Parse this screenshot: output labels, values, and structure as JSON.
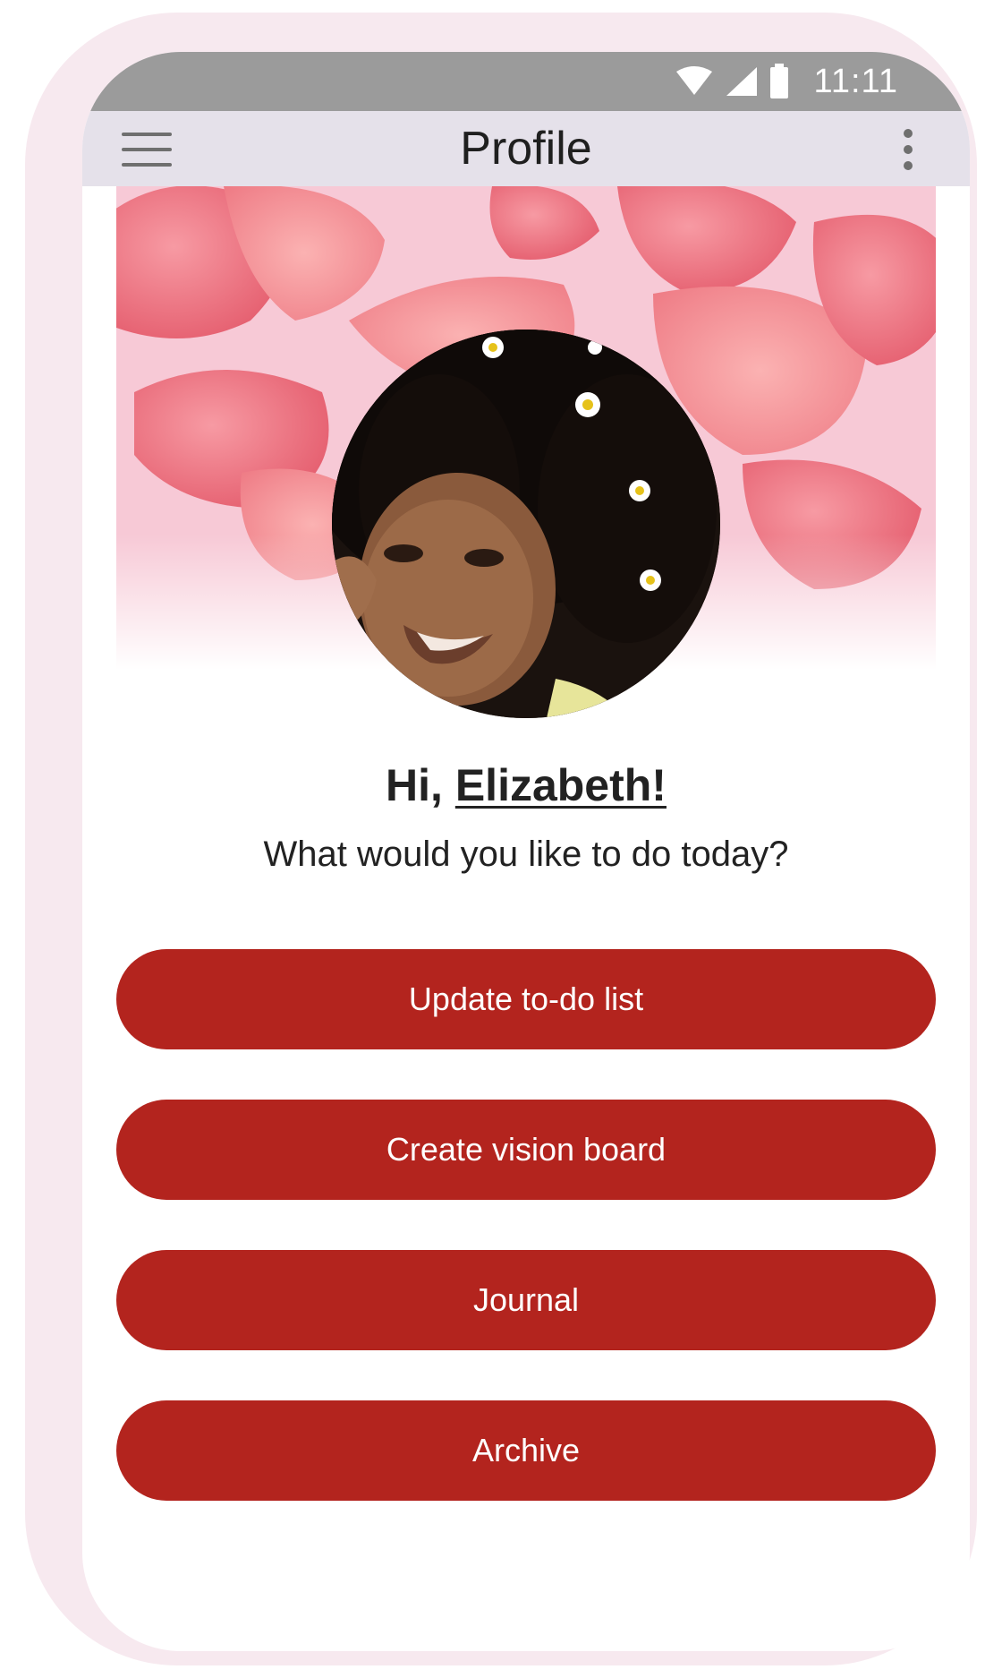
{
  "status_bar": {
    "time": "11:11",
    "icons": [
      "wifi-icon",
      "signal-icon",
      "battery-icon"
    ]
  },
  "app_bar": {
    "title": "Profile",
    "left_icon": "hamburger-menu-icon",
    "right_icon": "more-vertical-icon"
  },
  "profile": {
    "greeting_prefix": "Hi, ",
    "name": "Elizabeth!",
    "prompt": "What would you like to do today?"
  },
  "actions": [
    {
      "label": "Update to-do list"
    },
    {
      "label": "Create vision board"
    },
    {
      "label": "Journal"
    },
    {
      "label": "Archive"
    }
  ],
  "colors": {
    "accent": "#b3241e",
    "app_bar": "#e5e1ea",
    "status_bar": "#9b9b9b",
    "device_frame": "#f7e9ef"
  }
}
